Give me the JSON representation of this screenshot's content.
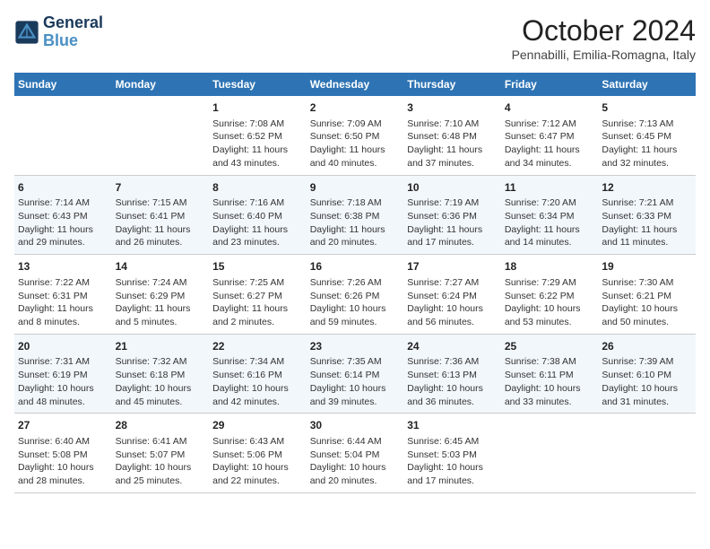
{
  "header": {
    "logo_line1": "General",
    "logo_line2": "Blue",
    "month": "October 2024",
    "location": "Pennabilli, Emilia-Romagna, Italy"
  },
  "weekdays": [
    "Sunday",
    "Monday",
    "Tuesday",
    "Wednesday",
    "Thursday",
    "Friday",
    "Saturday"
  ],
  "weeks": [
    [
      {
        "day": "",
        "text": ""
      },
      {
        "day": "",
        "text": ""
      },
      {
        "day": "1",
        "text": "Sunrise: 7:08 AM\nSunset: 6:52 PM\nDaylight: 11 hours and 43 minutes."
      },
      {
        "day": "2",
        "text": "Sunrise: 7:09 AM\nSunset: 6:50 PM\nDaylight: 11 hours and 40 minutes."
      },
      {
        "day": "3",
        "text": "Sunrise: 7:10 AM\nSunset: 6:48 PM\nDaylight: 11 hours and 37 minutes."
      },
      {
        "day": "4",
        "text": "Sunrise: 7:12 AM\nSunset: 6:47 PM\nDaylight: 11 hours and 34 minutes."
      },
      {
        "day": "5",
        "text": "Sunrise: 7:13 AM\nSunset: 6:45 PM\nDaylight: 11 hours and 32 minutes."
      }
    ],
    [
      {
        "day": "6",
        "text": "Sunrise: 7:14 AM\nSunset: 6:43 PM\nDaylight: 11 hours and 29 minutes."
      },
      {
        "day": "7",
        "text": "Sunrise: 7:15 AM\nSunset: 6:41 PM\nDaylight: 11 hours and 26 minutes."
      },
      {
        "day": "8",
        "text": "Sunrise: 7:16 AM\nSunset: 6:40 PM\nDaylight: 11 hours and 23 minutes."
      },
      {
        "day": "9",
        "text": "Sunrise: 7:18 AM\nSunset: 6:38 PM\nDaylight: 11 hours and 20 minutes."
      },
      {
        "day": "10",
        "text": "Sunrise: 7:19 AM\nSunset: 6:36 PM\nDaylight: 11 hours and 17 minutes."
      },
      {
        "day": "11",
        "text": "Sunrise: 7:20 AM\nSunset: 6:34 PM\nDaylight: 11 hours and 14 minutes."
      },
      {
        "day": "12",
        "text": "Sunrise: 7:21 AM\nSunset: 6:33 PM\nDaylight: 11 hours and 11 minutes."
      }
    ],
    [
      {
        "day": "13",
        "text": "Sunrise: 7:22 AM\nSunset: 6:31 PM\nDaylight: 11 hours and 8 minutes."
      },
      {
        "day": "14",
        "text": "Sunrise: 7:24 AM\nSunset: 6:29 PM\nDaylight: 11 hours and 5 minutes."
      },
      {
        "day": "15",
        "text": "Sunrise: 7:25 AM\nSunset: 6:27 PM\nDaylight: 11 hours and 2 minutes."
      },
      {
        "day": "16",
        "text": "Sunrise: 7:26 AM\nSunset: 6:26 PM\nDaylight: 10 hours and 59 minutes."
      },
      {
        "day": "17",
        "text": "Sunrise: 7:27 AM\nSunset: 6:24 PM\nDaylight: 10 hours and 56 minutes."
      },
      {
        "day": "18",
        "text": "Sunrise: 7:29 AM\nSunset: 6:22 PM\nDaylight: 10 hours and 53 minutes."
      },
      {
        "day": "19",
        "text": "Sunrise: 7:30 AM\nSunset: 6:21 PM\nDaylight: 10 hours and 50 minutes."
      }
    ],
    [
      {
        "day": "20",
        "text": "Sunrise: 7:31 AM\nSunset: 6:19 PM\nDaylight: 10 hours and 48 minutes."
      },
      {
        "day": "21",
        "text": "Sunrise: 7:32 AM\nSunset: 6:18 PM\nDaylight: 10 hours and 45 minutes."
      },
      {
        "day": "22",
        "text": "Sunrise: 7:34 AM\nSunset: 6:16 PM\nDaylight: 10 hours and 42 minutes."
      },
      {
        "day": "23",
        "text": "Sunrise: 7:35 AM\nSunset: 6:14 PM\nDaylight: 10 hours and 39 minutes."
      },
      {
        "day": "24",
        "text": "Sunrise: 7:36 AM\nSunset: 6:13 PM\nDaylight: 10 hours and 36 minutes."
      },
      {
        "day": "25",
        "text": "Sunrise: 7:38 AM\nSunset: 6:11 PM\nDaylight: 10 hours and 33 minutes."
      },
      {
        "day": "26",
        "text": "Sunrise: 7:39 AM\nSunset: 6:10 PM\nDaylight: 10 hours and 31 minutes."
      }
    ],
    [
      {
        "day": "27",
        "text": "Sunrise: 6:40 AM\nSunset: 5:08 PM\nDaylight: 10 hours and 28 minutes."
      },
      {
        "day": "28",
        "text": "Sunrise: 6:41 AM\nSunset: 5:07 PM\nDaylight: 10 hours and 25 minutes."
      },
      {
        "day": "29",
        "text": "Sunrise: 6:43 AM\nSunset: 5:06 PM\nDaylight: 10 hours and 22 minutes."
      },
      {
        "day": "30",
        "text": "Sunrise: 6:44 AM\nSunset: 5:04 PM\nDaylight: 10 hours and 20 minutes."
      },
      {
        "day": "31",
        "text": "Sunrise: 6:45 AM\nSunset: 5:03 PM\nDaylight: 10 hours and 17 minutes."
      },
      {
        "day": "",
        "text": ""
      },
      {
        "day": "",
        "text": ""
      }
    ]
  ]
}
